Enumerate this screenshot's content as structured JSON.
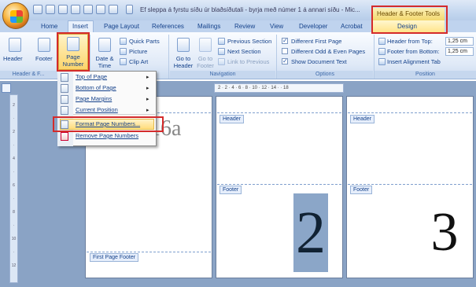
{
  "window": {
    "title": "Ef sleppa á fyrstu síðu úr blaðsíðutali - byrja með númer 1 á annari síðu - Mic...",
    "context_title": "Header & Footer Tools"
  },
  "tabs": [
    {
      "label": "Home"
    },
    {
      "label": "Insert"
    },
    {
      "label": "Page Layout"
    },
    {
      "label": "References"
    },
    {
      "label": "Mailings"
    },
    {
      "label": "Review"
    },
    {
      "label": "View"
    },
    {
      "label": "Developer"
    },
    {
      "label": "Acrobat"
    },
    {
      "label": "Design"
    }
  ],
  "ribbon": {
    "header_footer": {
      "header_label": "Header",
      "footer_label": "Footer",
      "page_number_label": "Page Number",
      "group_label": "Header & F..."
    },
    "insert": {
      "date_time_label": "Date & Time",
      "quick_parts_label": "Quick Parts",
      "picture_label": "Picture",
      "clip_art_label": "Clip Art"
    },
    "navigation": {
      "goto_header_label": "Go to Header",
      "goto_footer_label": "Go to Footer",
      "previous_section_label": "Previous Section",
      "next_section_label": "Next Section",
      "link_to_previous_label": "Link to Previous",
      "group_label": "Navigation"
    },
    "options": {
      "different_first_page": {
        "label": "Different First Page",
        "checked": true
      },
      "different_odd_even": {
        "label": "Different Odd & Even Pages",
        "checked": false
      },
      "show_document_text": {
        "label": "Show Document Text",
        "checked": true
      },
      "group_label": "Options"
    },
    "position": {
      "header_from_top_label": "Header from Top:",
      "header_from_top_value": "1,25 cm",
      "footer_from_bottom_label": "Footer from Bottom:",
      "footer_from_bottom_value": "1,25 cm",
      "insert_alignment_tab_label": "Insert Alignment Tab",
      "group_label": "Position"
    }
  },
  "page_number_menu": {
    "items": [
      {
        "label": "Top of Page",
        "has_submenu": true
      },
      {
        "label": "Bottom of Page",
        "has_submenu": true
      },
      {
        "label": "Page Margins",
        "has_submenu": true
      },
      {
        "label": "Current Position",
        "has_submenu": true
      },
      {
        "label": "Format Page Numbers...",
        "has_submenu": false,
        "highlighted": true
      },
      {
        "label": "Remove Page Numbers",
        "has_submenu": false
      }
    ]
  },
  "ruler": {
    "ticks": "2  ·  2  ·  4  ·  6  ·  8  ·  10  ·  12  ·  14  ·  ·  18"
  },
  "vruler": {
    "ticks": [
      "2",
      "·",
      "2",
      "·",
      "4",
      "·",
      "6",
      "·",
      "8",
      "·",
      "10",
      "·",
      "12"
    ]
  },
  "pages": [
    {
      "body_text": "16a",
      "footer_tag": "First Page Footer"
    },
    {
      "header_tag": "Header",
      "footer_tag": "Footer",
      "page_number": "2"
    },
    {
      "header_tag": "Header",
      "footer_tag": "Footer",
      "page_number": "3"
    }
  ],
  "colors": {
    "annotation_red": "#d42b2b",
    "ribbon_blue": "#dfe9f7",
    "context_yellow": "#f3d86e",
    "selected_number_bg": "#8ba6c8"
  }
}
